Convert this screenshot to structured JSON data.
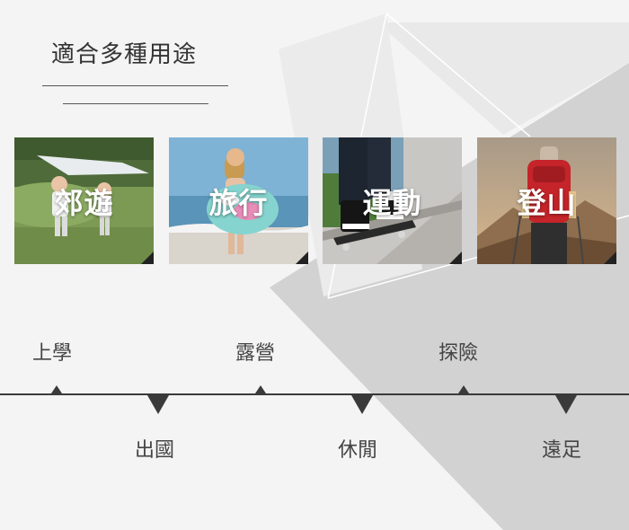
{
  "header": {
    "title": "適合多種用途"
  },
  "cards": [
    {
      "label": "郊遊",
      "icon": "kids-kite-photo"
    },
    {
      "label": "旅行",
      "icon": "beach-bag-photo"
    },
    {
      "label": "運動",
      "icon": "skateboard-photo"
    },
    {
      "label": "登山",
      "icon": "hiker-photo"
    }
  ],
  "timeline": {
    "above": [
      "上學",
      "露營",
      "探險"
    ],
    "below": [
      "出國",
      "休閒",
      "遠足"
    ]
  },
  "colors": {
    "line": "#3a3a3a",
    "background": "#f4f4f4",
    "shadow": "#cfcfcf"
  }
}
